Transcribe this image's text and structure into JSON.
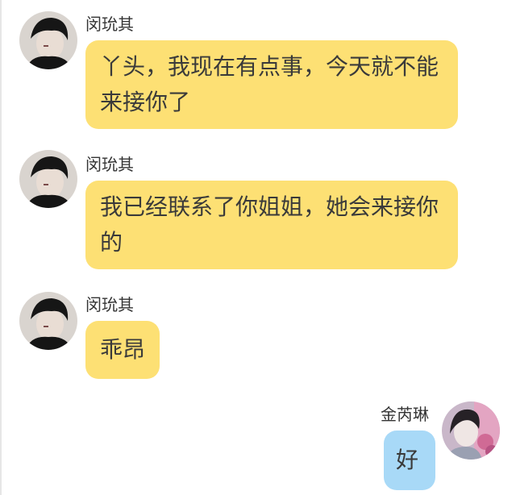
{
  "messages": [
    {
      "side": "left",
      "sender": "闵玧其",
      "avatar": "male-avatar-icon",
      "text": "丫头，我现在有点事，今天就不能来接你了"
    },
    {
      "side": "left",
      "sender": "闵玧其",
      "avatar": "male-avatar-icon",
      "text": "我已经联系了你姐姐，她会来接你的"
    },
    {
      "side": "left",
      "sender": "闵玧其",
      "avatar": "male-avatar-icon",
      "text": "乖昂"
    },
    {
      "side": "right",
      "sender": "金芮琳",
      "avatar": "female-avatar-icon",
      "text": "好"
    }
  ],
  "colors": {
    "left_bubble": "#fde074",
    "right_bubble": "#a8d9f7"
  }
}
